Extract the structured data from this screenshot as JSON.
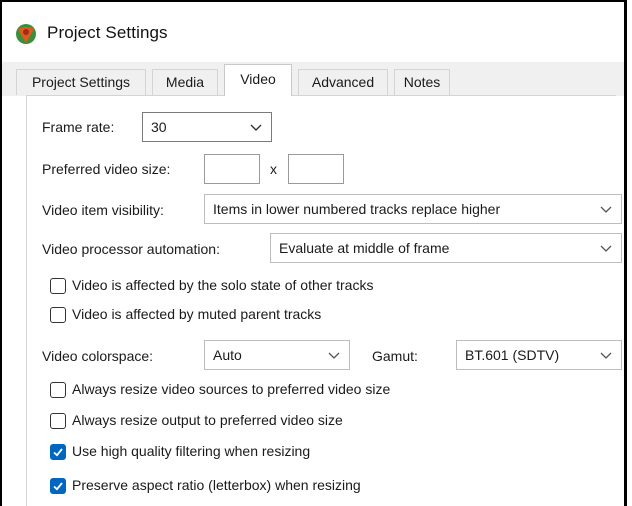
{
  "window": {
    "title": "Project Settings",
    "app_icon": "reaper-logo-icon"
  },
  "tabs": [
    {
      "label": "Project Settings",
      "active": false
    },
    {
      "label": "Media",
      "active": false
    },
    {
      "label": "Video",
      "active": true
    },
    {
      "label": "Advanced",
      "active": false
    },
    {
      "label": "Notes",
      "active": false
    }
  ],
  "video": {
    "frame_rate": {
      "label": "Frame rate:",
      "value": "30"
    },
    "preferred_size": {
      "label": "Preferred video size:",
      "width": "",
      "height": "",
      "separator": "x"
    },
    "item_visibility": {
      "label": "Video item visibility:",
      "value": "Items in lower numbered tracks replace higher"
    },
    "processor_automation": {
      "label": "Video processor automation:",
      "value": "Evaluate at middle of frame"
    },
    "checks_top": [
      {
        "label": "Video is affected by the solo state of other tracks",
        "checked": false
      },
      {
        "label": "Video is affected by muted parent tracks",
        "checked": false
      }
    ],
    "colorspace": {
      "label": "Video colorspace:",
      "value": "Auto"
    },
    "gamut": {
      "label": "Gamut:",
      "value": "BT.601 (SDTV)"
    },
    "checks_bottom": [
      {
        "label": "Always resize video sources to preferred video size",
        "checked": false
      },
      {
        "label": "Always resize output to preferred video size",
        "checked": false
      },
      {
        "label": "Use high quality filtering when resizing",
        "checked": true
      },
      {
        "label": "Preserve aspect ratio (letterbox) when resizing",
        "checked": true
      }
    ]
  },
  "colors": {
    "accent": "#0067c0",
    "tab_strip": "#f0f0f0"
  }
}
